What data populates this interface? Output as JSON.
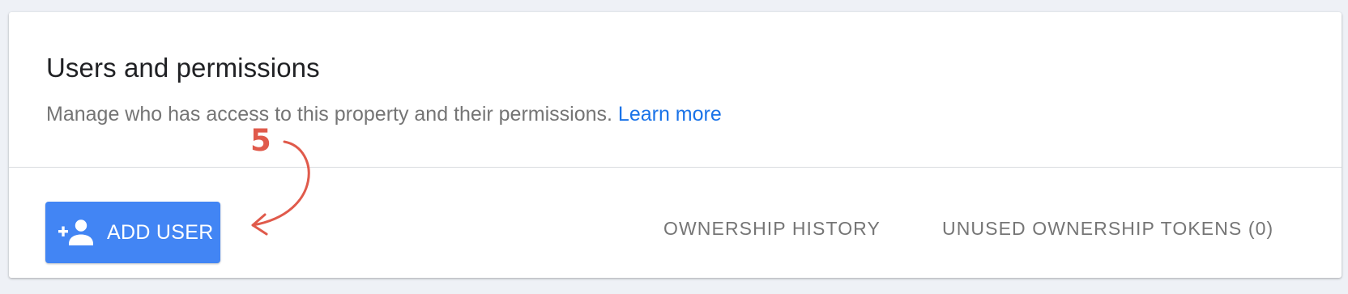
{
  "header": {
    "title": "Users and permissions",
    "subtitle": "Manage who has access to this property and their permissions.",
    "learn_more_label": "Learn more"
  },
  "actions": {
    "add_user": {
      "label": "ADD USER",
      "icon": "person-add-icon"
    },
    "ownership_history_label": "OWNERSHIP HISTORY",
    "unused_tokens_label": "UNUSED OWNERSHIP TOKENS (0)"
  },
  "annotation": {
    "step_number": "5",
    "color": "#e05a4b"
  },
  "colors": {
    "accent": "#4285f4",
    "link": "#1a73e8",
    "muted_text": "#757575",
    "background": "#eef1f6"
  }
}
